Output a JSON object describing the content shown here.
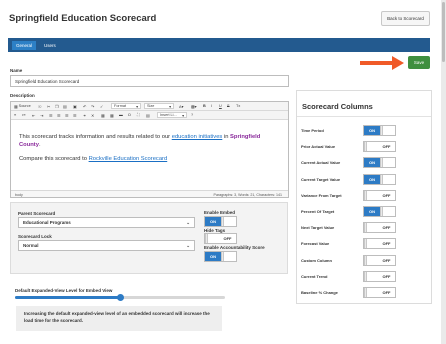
{
  "page": {
    "title": "Springfield Education Scorecard",
    "back_button": "Back to Scorecard",
    "save_button": "Save"
  },
  "tabs": [
    {
      "label": "General",
      "active": true
    },
    {
      "label": "Users",
      "active": false
    }
  ],
  "form": {
    "name_label": "Name",
    "name_value": "Springfield Education Scorecard",
    "description_label": "Description"
  },
  "editor": {
    "toolbar": {
      "source": "Source",
      "format": "Format",
      "size": "Size",
      "bold": "B",
      "italic": "I",
      "underline": "U",
      "strike": "S",
      "clear": "Tx",
      "insert_link": "Insert Li..."
    },
    "paragraph1_before": "This scorecard tracks information and results related to our ",
    "paragraph1_link": "education initiatives",
    "paragraph1_mid": " in ",
    "paragraph1_bold": "Springfield County",
    "paragraph1_end": ".",
    "paragraph2_before": "Compare this scorecard to ",
    "paragraph2_link": "Rockville Education Scorecard",
    "status_left": "body",
    "status_right": "Paragraphs: 3, Words: 21, Characters: 141"
  },
  "settings": {
    "parent_label": "Parent Scorecard",
    "parent_value": "Educational Programs",
    "lock_label": "Scorecard Lock",
    "lock_value": "Normal",
    "embed_label": "Enable Embed",
    "embed_state": "ON",
    "hide_tags_label": "Hide Tags",
    "hide_tags_state": "OFF",
    "accountability_label": "Enable Accountability Score",
    "accountability_state": "ON"
  },
  "embed_view": {
    "label": "Default Expanded-View Level for Embed View",
    "level_fraction": 0.5,
    "note": "Increasing the default expanded-view level of an embedded scorecard will increase the load time for the scorecard."
  },
  "scorecard_columns": {
    "title": "Scorecard Columns",
    "on_label": "ON",
    "off_label": "OFF",
    "columns": [
      {
        "label": "Time Period",
        "on": true
      },
      {
        "label": "Prior Actual Value",
        "on": false
      },
      {
        "label": "Current Actual Value",
        "on": true
      },
      {
        "label": "Current Target Value",
        "on": true
      },
      {
        "label": "Variance From Target",
        "on": false
      },
      {
        "label": "Percent Of Target",
        "on": true
      },
      {
        "label": "Next Target Value",
        "on": false
      },
      {
        "label": "Forecast Value",
        "on": false
      },
      {
        "label": "Custom Column",
        "on": false
      },
      {
        "label": "Current Trend",
        "on": false
      },
      {
        "label": "Baseline % Change",
        "on": false
      }
    ]
  },
  "colors": {
    "tabbar": "#235a8f",
    "accent": "#2d7bc5",
    "save": "#3f8f3f",
    "arrow": "#f05a28"
  }
}
